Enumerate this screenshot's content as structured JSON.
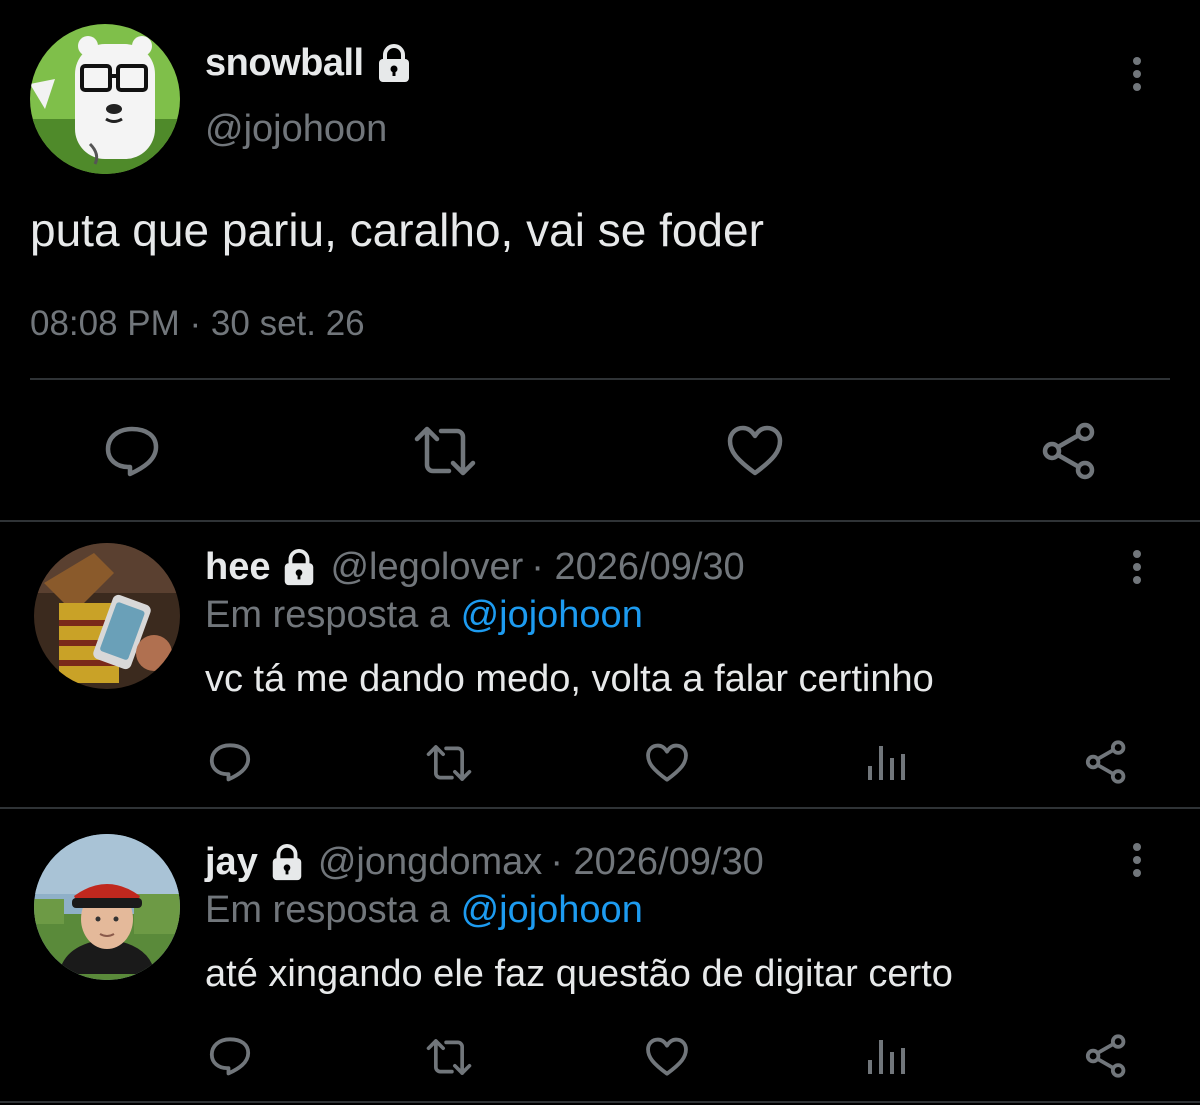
{
  "main_tweet": {
    "display_name": "snowball",
    "handle": "@jojohoon",
    "text": "puta que pariu, caralho, vai se foder",
    "timestamp": "08:08 PM · 30 set. 26",
    "avatar_icon": "bear-glasses-avatar",
    "protected_icon": "lock-icon",
    "actions": [
      "reply-icon",
      "retweet-icon",
      "like-icon",
      "share-icon"
    ]
  },
  "replies": [
    {
      "display_name": "hee",
      "handle": "@legolover",
      "date": "· 2026/09/30",
      "in_reply_prefix": "Em resposta a",
      "in_reply_handle": "@jojohoon",
      "text": "vc tá me dando medo, volta a falar certinho",
      "avatar_icon": "woody-phone-avatar",
      "actions": [
        "reply-icon",
        "retweet-icon",
        "like-icon",
        "analytics-icon",
        "share-icon"
      ]
    },
    {
      "display_name": "jay",
      "handle": "@jongdomax",
      "date": "· 2026/09/30",
      "in_reply_prefix": "Em resposta a",
      "in_reply_handle": "@jojohoon",
      "text": "até xingando ele faz questão de digitar certo",
      "avatar_icon": "man-red-cap-avatar",
      "actions": [
        "reply-icon",
        "retweet-icon",
        "like-icon",
        "analytics-icon",
        "share-icon"
      ]
    }
  ],
  "colors": {
    "background": "#000000",
    "text": "#e7e9ea",
    "muted": "#71767b",
    "link": "#1d9bf0",
    "divider": "#2f3336"
  }
}
